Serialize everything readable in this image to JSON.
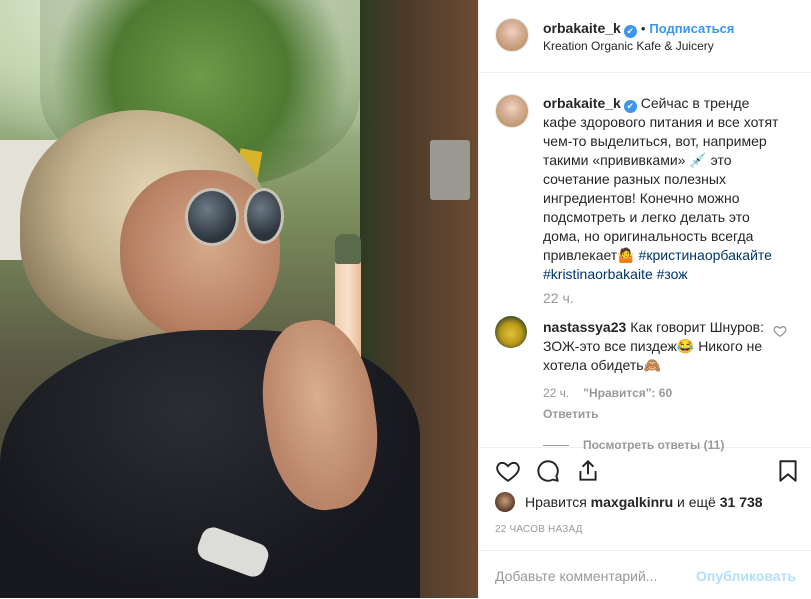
{
  "header": {
    "username": "orbakaite_k",
    "verified_mark": "✔",
    "separator": "•",
    "follow_label": "Подписаться",
    "location": "Kreation Organic Kafe & Juicery"
  },
  "caption": {
    "username": "orbakaite_k",
    "text": "Сейчас в тренде кафе здорового питания и все хотят чем-то выделиться, вот, например такими «прививками» 💉 это сочетание разных полезных ингредиентов! Конечно можно подсмотреть и легко делать это дома, но оригинальность всегда привлекает🤷",
    "hashtags": [
      "#кристинаорбакайте",
      "#kristinaorbakaite",
      "#зож"
    ],
    "time": "22 ч."
  },
  "comment": {
    "username": "nastassya23",
    "text": "Как говорит Шнуров: ЗОЖ-это все пиздеж😂 Никого не хотела обидеть🙈",
    "time": "22 ч.",
    "likes": "\"Нравится\": 60",
    "reply_label": "Ответить",
    "view_replies": "Посмотреть ответы (11)"
  },
  "actions": {
    "icons": [
      "heart-icon",
      "comment-icon",
      "share-icon",
      "bookmark-icon"
    ]
  },
  "likes": {
    "prefix": "Нравится",
    "liker": "maxgalkinru",
    "connector": "и ещё",
    "count": "31 738"
  },
  "posted_ago": "22 ЧАСОВ НАЗАД",
  "add_comment": {
    "placeholder": "Добавьте комментарий...",
    "publish_label": "Опубликовать"
  },
  "colors": {
    "accent": "#3897f0",
    "hashtag": "#003569",
    "muted": "#999999",
    "publish_disabled": "#b2dffc"
  }
}
